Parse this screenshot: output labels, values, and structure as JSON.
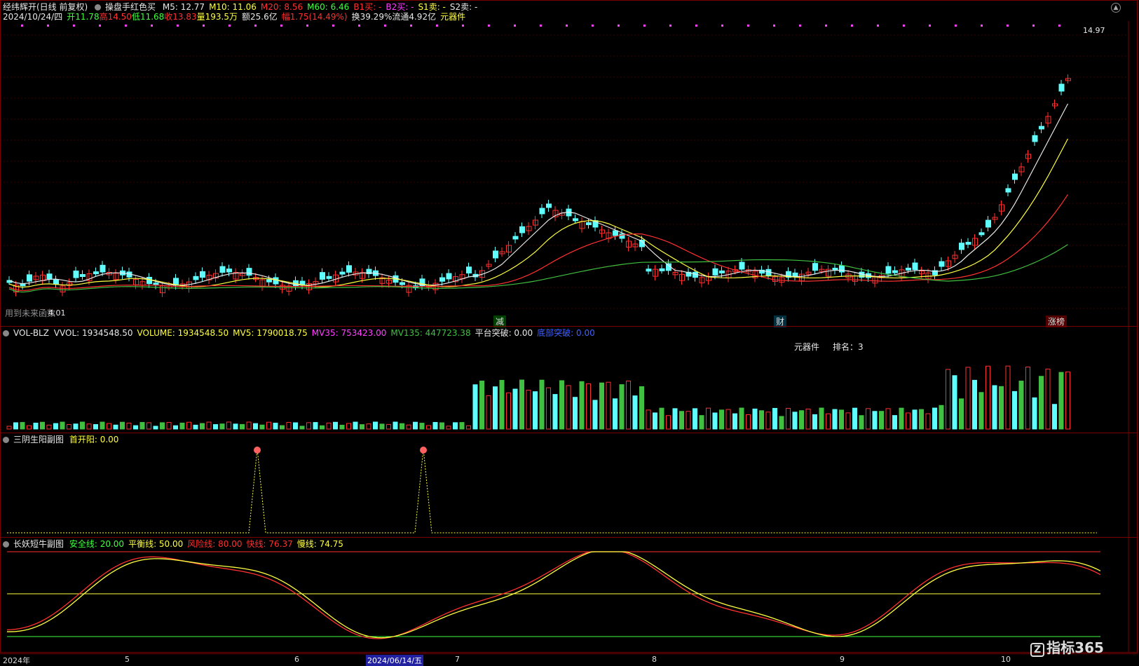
{
  "main": {
    "title": "经纬辉开(日线 前复权)",
    "indicator_name": "操盘手红色买",
    "ma": [
      {
        "label": "M5: 12.77",
        "color": "#e8e8e8"
      },
      {
        "label": "M10: 11.06",
        "color": "#ffff40"
      },
      {
        "label": "M20: 8.56",
        "color": "#ff3030"
      },
      {
        "label": "M60: 6.46",
        "color": "#40ff40"
      },
      {
        "label": "B1买: -",
        "color": "#ff3030"
      },
      {
        "label": "B2买: -",
        "color": "#ff40ff"
      },
      {
        "label": "S1卖: -",
        "color": "#ffff40"
      },
      {
        "label": "S2卖: -",
        "color": "#e8e8e8"
      }
    ],
    "info": {
      "date": "2024/10/24/四",
      "open": "开11.78",
      "high": "高14.50",
      "low": "低11.68",
      "close": "收13.83",
      "vol": "量193.5万",
      "amount": "额25.6亿",
      "change": "幅1.75(14.49%)",
      "turnover": "换39.29%",
      "float": "流通4.92亿",
      "sector": "元器件"
    },
    "high_label": "14.97",
    "low_label": "4.01",
    "bottom_note": "用到未来函数",
    "tags": [
      {
        "text": "减",
        "color": "#40ff40"
      },
      {
        "text": "财",
        "color": "#60ffff"
      },
      {
        "text": "涨榜",
        "color": "#ff3030"
      }
    ]
  },
  "vol_panel": {
    "name": "VOL-BLZ",
    "items": [
      {
        "label": "VVOL: 1934548.50",
        "color": "#e8e8e8"
      },
      {
        "label": "VOLUME: 1934548.50",
        "color": "#ffff40"
      },
      {
        "label": "MV5: 1790018.75",
        "color": "#ffff40"
      },
      {
        "label": "MV35: 753423.00",
        "color": "#ff40ff"
      },
      {
        "label": "MV135: 447723.38",
        "color": "#40c040"
      },
      {
        "label": "平台突破: 0.00",
        "color": "#e8e8e8"
      },
      {
        "label": "底部突破: 0.00",
        "color": "#4060ff"
      }
    ],
    "sector_label": "元器件",
    "rank_label": "排名：3"
  },
  "sub1": {
    "name": "三阴生阳副图",
    "items": [
      {
        "label": "首开阳: 0.00",
        "color": "#ffff40"
      }
    ]
  },
  "sub2": {
    "name": "长妖短牛副图",
    "items": [
      {
        "label": "安全线: 20.00",
        "color": "#40ff40"
      },
      {
        "label": "平衡线: 50.00",
        "color": "#ffff40"
      },
      {
        "label": "风险线: 80.00",
        "color": "#ff3030"
      },
      {
        "label": "快线: 76.37",
        "color": "#ff3030"
      },
      {
        "label": "慢线: 74.75",
        "color": "#ffff40"
      }
    ]
  },
  "x_axis": {
    "labels": [
      "2024年",
      "5",
      "6",
      "7",
      "8",
      "9",
      "10"
    ],
    "cursor_date": "2024/06/14/五"
  },
  "logo": "指标365"
}
